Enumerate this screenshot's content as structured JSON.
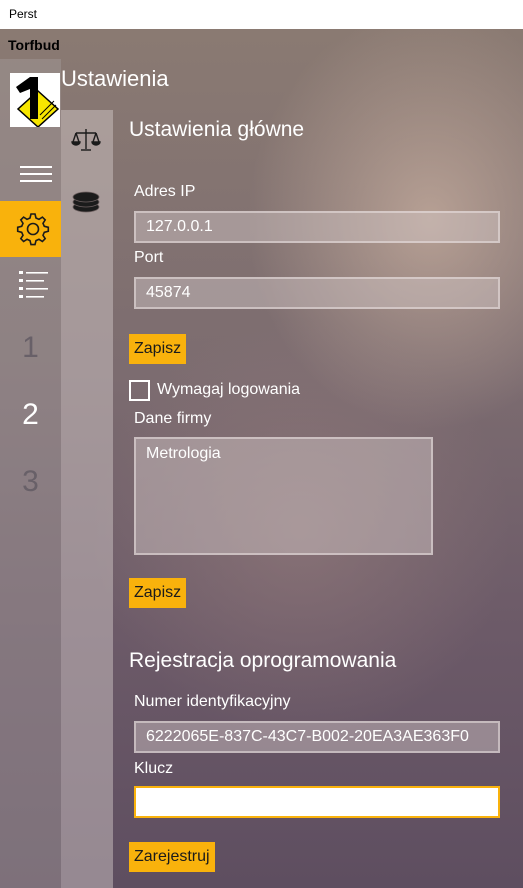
{
  "window": {
    "title": "Perst"
  },
  "app": {
    "title": "Torfbud"
  },
  "page": {
    "header": "Ustawienia"
  },
  "nav": {
    "items": [
      {
        "icon": "hamburger-icon"
      },
      {
        "icon": "gear-icon",
        "selected": true
      },
      {
        "icon": "list-icon"
      },
      {
        "label": "1"
      },
      {
        "label": "2"
      },
      {
        "label": "3"
      }
    ]
  },
  "subnav": {
    "items": [
      {
        "icon": "scales-icon"
      },
      {
        "icon": "database-icon"
      }
    ]
  },
  "general": {
    "title": "Ustawienia główne",
    "ip_label": "Adres IP",
    "ip_value": "127.0.0.1",
    "port_label": "Port",
    "port_value": "45874",
    "save_label": "Zapisz",
    "require_login_label": "Wymagaj logowania",
    "require_login_checked": false,
    "company_label": "Dane firmy",
    "company_value": "Metrologia",
    "save2_label": "Zapisz"
  },
  "registration": {
    "title": "Rejestracja oprogramowania",
    "id_label": "Numer identyfikacyjny",
    "id_value": "6222065E-837C-43C7-B002-20EA3AE363F0",
    "key_label": "Klucz",
    "key_value": "",
    "register_label": "Zarejestruj"
  },
  "colors": {
    "accent": "#f9b20c",
    "logo_yellow": "#f7e600"
  }
}
